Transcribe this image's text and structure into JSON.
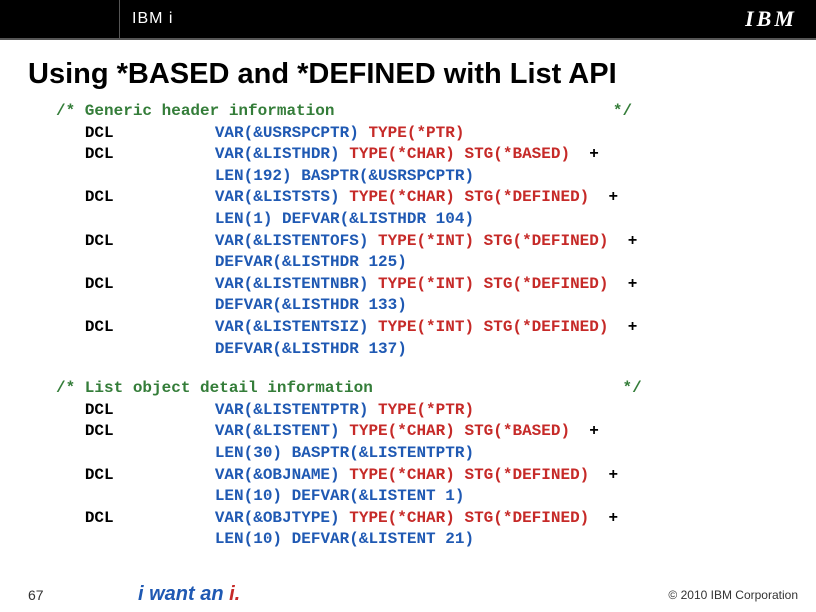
{
  "header": {
    "brand": "IBM i",
    "logo": "IBM"
  },
  "slide": {
    "title": "Using *BASED and *DEFINED with List API"
  },
  "code": {
    "comment1_open": "/* Generic header information",
    "comment_close": "*/",
    "dcl": "DCL",
    "l1_var": "VAR(&USRSPCPTR)",
    "l1_type": " TYPE(*PTR)",
    "l2_var": "VAR(&LISTHDR)",
    "l2_type": " TYPE(*CHAR)",
    "l2_stg": " STG(*BASED)",
    "l2_plus": "  +",
    "l2b_len": "LEN(192)",
    "l2b_bas": " BASPTR(&USRSPCPTR)",
    "l3_var": "VAR(&LISTSTS)",
    "l3_type": " TYPE(*CHAR)",
    "l3_stg": " STG(*DEFINED)",
    "l3_plus": "  +",
    "l3b_len": "LEN(1)",
    "l3b_def": " DEFVAR(&LISTHDR 104)",
    "l4_var": "VAR(&LISTENTOFS)",
    "l4_type": " TYPE(*INT)",
    "l4_stg": " STG(*DEFINED)",
    "l4_plus": "  +",
    "l4b_def": "DEFVAR(&LISTHDR 125)",
    "l5_var": "VAR(&LISTENTNBR)",
    "l5_type": " TYPE(*INT)",
    "l5_stg": " STG(*DEFINED)",
    "l5_plus": "  +",
    "l5b_def": "DEFVAR(&LISTHDR 133)",
    "l6_var": "VAR(&LISTENTSIZ)",
    "l6_type": " TYPE(*INT)",
    "l6_stg": " STG(*DEFINED)",
    "l6_plus": "  +",
    "l6b_def": "DEFVAR(&LISTHDR 137)",
    "comment2_open": "/* List object detail information",
    "b2l1_var": "VAR(&LISTENTPTR)",
    "b2l1_type": " TYPE(*PTR)",
    "b2l2_var": "VAR(&LISTENT)",
    "b2l2_type": " TYPE(*CHAR)",
    "b2l2_stg": " STG(*BASED)",
    "b2l2_plus": "  +",
    "b2l2b_len": "LEN(30)",
    "b2l2b_bas": " BASPTR(&LISTENTPTR)",
    "b2l3_var": "VAR(&OBJNAME)",
    "b2l3_type": " TYPE(*CHAR)",
    "b2l3_stg": " STG(*DEFINED)",
    "b2l3_plus": "  +",
    "b2l3b_len": "LEN(10)",
    "b2l3b_def": " DEFVAR(&LISTENT 1)",
    "b2l4_var": "VAR(&OBJTYPE)",
    "b2l4_type": " TYPE(*CHAR)",
    "b2l4_stg": " STG(*DEFINED)",
    "b2l4_plus": "  +",
    "b2l4b_len": "LEN(10)",
    "b2l4b_def": " DEFVAR(&LISTENT 21)"
  },
  "footer": {
    "page": "67",
    "tagline_pre": "i want an ",
    "tagline_i": "i.",
    "copyright": "© 2010 IBM Corporation"
  }
}
